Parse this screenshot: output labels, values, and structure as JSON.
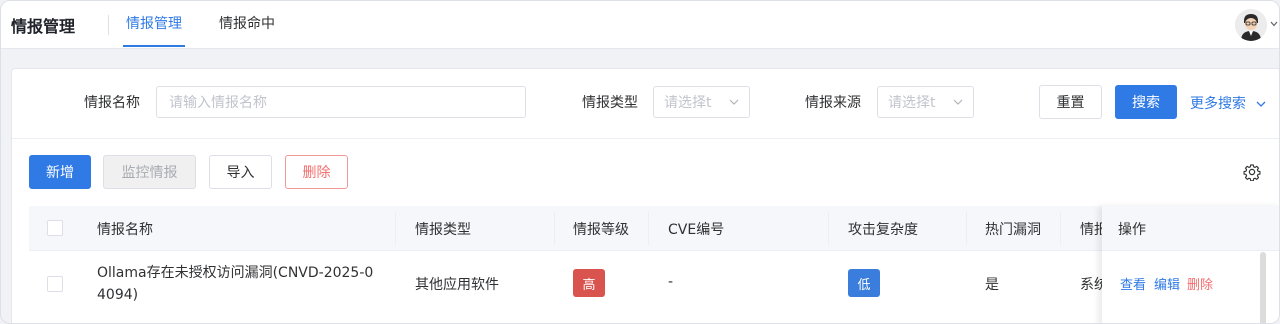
{
  "header": {
    "app_title": "情报管理",
    "tabs": [
      {
        "label": "情报管理",
        "active": true
      },
      {
        "label": "情报命中",
        "active": false
      }
    ]
  },
  "search": {
    "name_label": "情报名称",
    "name_placeholder": "请输入情报名称",
    "type_label": "情报类型",
    "type_placeholder": "请选择t",
    "source_label": "情报来源",
    "source_placeholder": "请选择t",
    "reset": "重置",
    "search": "搜索",
    "more": "更多搜索"
  },
  "toolbar": {
    "add": "新增",
    "monitor": "监控情报",
    "import": "导入",
    "delete": "删除"
  },
  "table": {
    "columns": [
      "情报名称",
      "情报类型",
      "情报等级",
      "CVE编号",
      "攻击复杂度",
      "热门漏洞",
      "情报",
      "操作"
    ],
    "rows": [
      {
        "name_line1": "Ollama存在未授权访问漏洞(CNVD-2025-0",
        "name_line2": "4094)",
        "type": "其他应用软件",
        "level": "高",
        "cve": "-",
        "complexity": "低",
        "hot": "是",
        "source": "系统",
        "actions": [
          "查看",
          "编辑",
          "删除"
        ]
      }
    ]
  },
  "colors": {
    "primary": "#2f7ae5",
    "danger_tag": "#d9534f",
    "low_tag": "#3b7ddd",
    "danger_text": "#f56c6c"
  }
}
